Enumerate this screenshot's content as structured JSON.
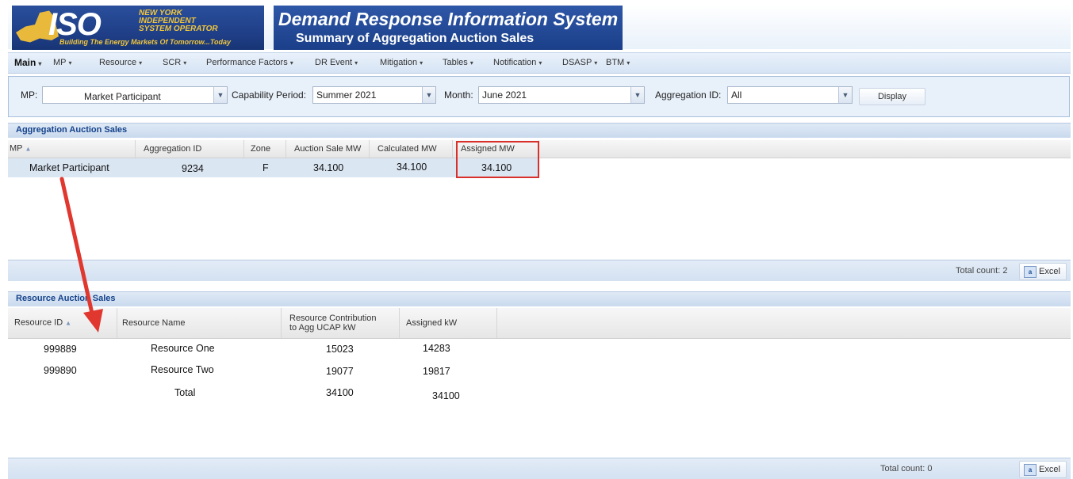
{
  "header": {
    "logo": {
      "mark": "ISO",
      "org_line1": "NEW YORK",
      "org_line2": "INDEPENDENT",
      "org_line3": "SYSTEM OPERATOR",
      "tagline": "Building The Energy Markets Of Tomorrow...Today"
    },
    "title": "Demand Response Information System",
    "subtitle": "Summary of Aggregation Auction Sales"
  },
  "menu": {
    "items": [
      {
        "label": "Main"
      },
      {
        "label": "MP"
      },
      {
        "label": "Resource"
      },
      {
        "label": "SCR"
      },
      {
        "label": "Performance Factors"
      },
      {
        "label": "DR Event"
      },
      {
        "label": "Mitigation"
      },
      {
        "label": "Tables"
      },
      {
        "label": "Notification"
      },
      {
        "label": "DSASP"
      },
      {
        "label": "BTM"
      }
    ],
    "caret": "▾"
  },
  "filters": {
    "mp_label": "MP:",
    "mp_value": "Market Participant",
    "capability_label": "Capability Period:",
    "capability_value": "Summer 2021",
    "month_label": "Month:",
    "month_value": "June 2021",
    "aggregation_label": "Aggregation ID:",
    "aggregation_value": "All",
    "display_button": "Display"
  },
  "aggregation_panel": {
    "title": "Aggregation Auction Sales",
    "columns": [
      "MP",
      "Aggregation ID",
      "Zone",
      "Auction Sale MW",
      "Calculated MW",
      "Assigned MW"
    ],
    "rows": [
      {
        "mp": "Market Participant",
        "aggregation_id": "9234",
        "zone": "F",
        "auction_sale_mw": "34.100",
        "calculated_mw": "34.100",
        "assigned_mw": "34.100"
      }
    ],
    "total_count": "Total count: 2",
    "excel_label": "Excel"
  },
  "resource_panel": {
    "title": "Resource Auction Sales",
    "columns": [
      "Resource ID",
      "Resource Name",
      "Resource Contribution to Agg UCAP kW",
      "Assigned kW"
    ],
    "col3_line1": "Resource Contribution",
    "col3_line2": "to Agg UCAP kW",
    "rows": [
      {
        "resource_id": "999889",
        "resource_name": "Resource One",
        "contribution": "15023",
        "assigned_kw": "14283"
      },
      {
        "resource_id": "999890",
        "resource_name": "Resource Two",
        "contribution": "19077",
        "assigned_kw": "19817"
      },
      {
        "resource_id": "",
        "resource_name": "Total",
        "contribution": "34100",
        "assigned_kw": "34100"
      }
    ],
    "total_count": "Total count: 0",
    "excel_label": "Excel"
  },
  "colors": {
    "accent": "#15428b",
    "highlight": "#d9302b",
    "header_blue": "#1e3d85",
    "logo_gold": "#f1c63b"
  },
  "icons": {
    "sort": "sort-ascending-icon",
    "excel": "excel-icon",
    "dropdown": "chevron-down-icon"
  }
}
